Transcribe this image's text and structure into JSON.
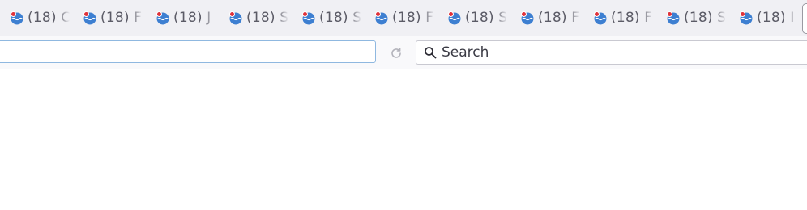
{
  "tabs": [
    {
      "label": "(18) C"
    },
    {
      "label": "(18) F"
    },
    {
      "label": "(18) J"
    },
    {
      "label": "(18) S"
    },
    {
      "label": "(18) S"
    },
    {
      "label": "(18) F"
    },
    {
      "label": "(18) S"
    },
    {
      "label": "(18) F"
    },
    {
      "label": "(18) F"
    },
    {
      "label": "(18) S"
    },
    {
      "label": "(18) I"
    }
  ],
  "tab_favicon": "globe-with-notification-dot-icon",
  "navbar": {
    "url_value": "",
    "reload_icon": "reload-icon",
    "search_placeholder": "Search",
    "search_icon": "magnifier-icon"
  },
  "colors": {
    "favicon_blue": "#3d7fd1",
    "favicon_dot": "#e0323a",
    "tab_text": "#5b5b66",
    "urlbar_focus_border": "#8fb8e0"
  }
}
